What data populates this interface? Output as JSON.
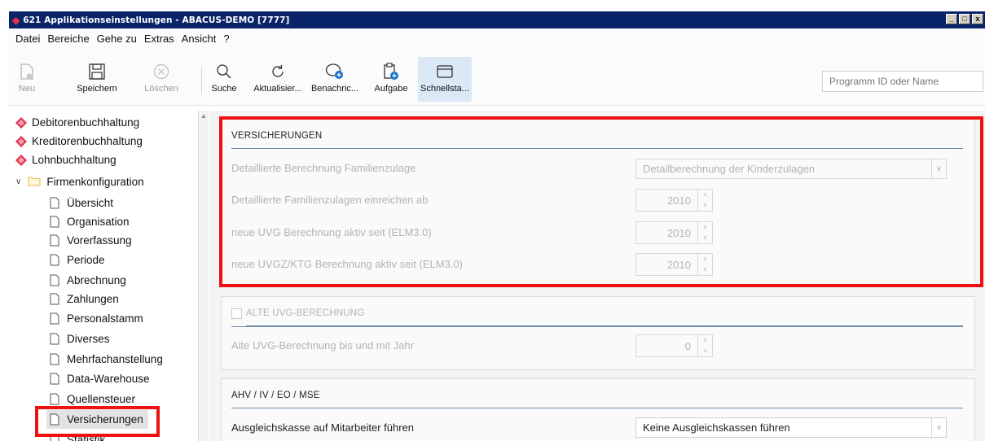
{
  "window": {
    "title": "621 Applikationseinstellungen - ABACUS-DEMO [7777]",
    "controls": [
      "_",
      "□",
      "x"
    ]
  },
  "menu": [
    "Datei",
    "Bereiche",
    "Gehe zu",
    "Extras",
    "Ansicht",
    "?"
  ],
  "toolbar": {
    "neu": "Neu",
    "speichern": "Speichern",
    "loeschen": "Löschen",
    "suche": "Suche",
    "aktualisieren": "Aktualisier...",
    "benachrichtigung": "Benachric...",
    "aufgabe": "Aufgabe",
    "schnellstart": "Schnellsta...",
    "program_placeholder": "Programm ID oder Name"
  },
  "tree": {
    "root_items": [
      "Debitorenbuchhaltung",
      "Kreditorenbuchhaltung",
      "Lohnbuchhaltung"
    ],
    "folder": "Firmenkonfiguration",
    "children": [
      "Übersicht",
      "Organisation",
      "Vorerfassung",
      "Periode",
      "Abrechnung",
      "Zahlungen",
      "Personalstamm",
      "Diverses",
      "Mehrfachanstellung",
      "Data-Warehouse",
      "Quellensteuer",
      "Versicherungen",
      "Statistik"
    ],
    "selected": "Versicherungen"
  },
  "versicherungen": {
    "header": "VERSICHERUNGEN",
    "rows": [
      {
        "label": "Detaillierte Berechnung Familienzulage",
        "value": "Detailberechnung der Kinderzulagen"
      },
      {
        "label": "Detaillierte Familienzulagen einreichen ab",
        "value": "2010"
      },
      {
        "label": "neue UVG Berechnung aktiv seit (ELM3.0)",
        "value": "2010"
      },
      {
        "label": "neue UVGZ/KTG Berechnung aktiv seit (ELM3.0)",
        "value": "2010"
      }
    ]
  },
  "alte_uvg": {
    "header": "ALTE UVG-BERECHNUNG",
    "row_label": "Alte UVG-Berechnung bis und mit Jahr",
    "value": "0"
  },
  "ahv": {
    "header": "AHV / IV / EO / MSE",
    "row_label": "Ausgleichskasse auf Mitarbeiter führen",
    "value": "Keine Ausgleichskassen führen"
  },
  "colors": {
    "highlight": "#ee1111",
    "title_bar": "#0a246a",
    "app_icon": "#e0334a"
  }
}
